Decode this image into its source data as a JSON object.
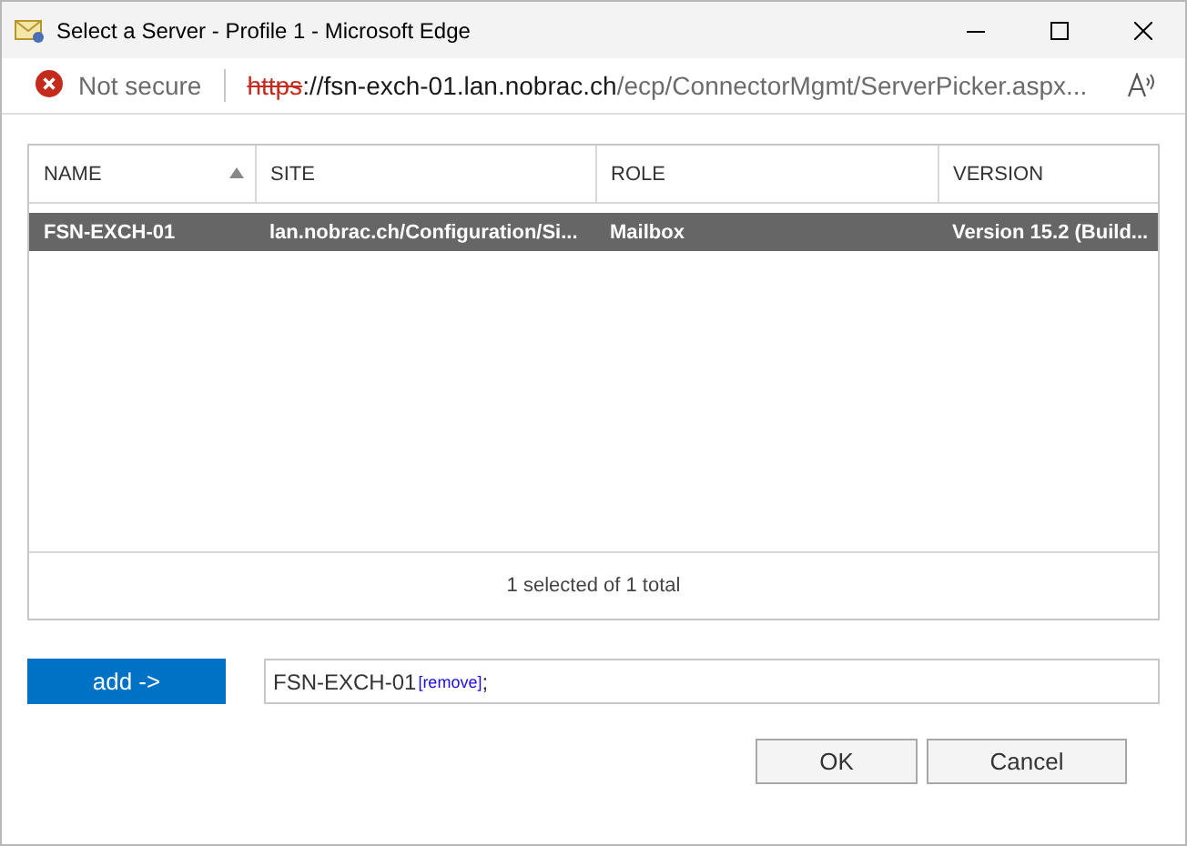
{
  "window": {
    "title": "Select a Server - Profile 1 - Microsoft Edge"
  },
  "address_bar": {
    "security": "Not secure",
    "secure": false,
    "scheme": "https",
    "host": "://fsn-exch-01.lan.nobrac.ch",
    "path": "/ecp/ConnectorMgmt/ServerPicker.aspx..."
  },
  "table": {
    "columns": [
      {
        "label": "NAME",
        "sorted": true
      },
      {
        "label": "SITE",
        "sorted": false
      },
      {
        "label": "ROLE",
        "sorted": false
      },
      {
        "label": "VERSION",
        "sorted": false
      }
    ],
    "rows": [
      {
        "cells": [
          "FSN-EXCH-01",
          "lan.nobrac.ch/Configuration/Si...",
          "Mailbox",
          "Version 15.2 (Build..."
        ],
        "selected": true
      }
    ],
    "status": "1 selected of 1 total"
  },
  "add_button": "add ->",
  "selection": [
    {
      "name": "FSN-EXCH-01",
      "link": "[remove]",
      "separator": ";"
    }
  ],
  "buttons": [
    "OK",
    "Cancel"
  ]
}
